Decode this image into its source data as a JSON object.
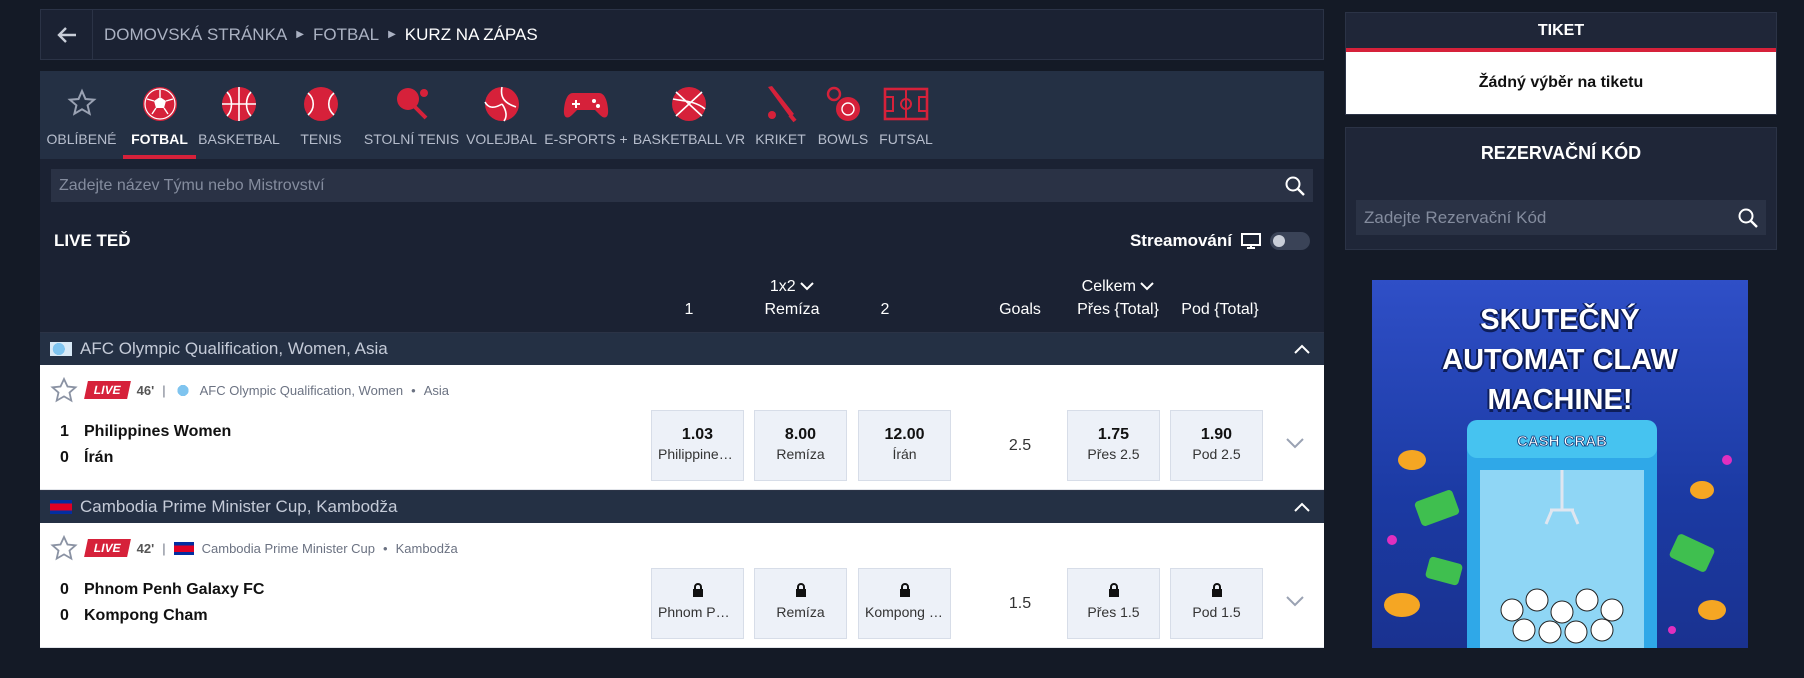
{
  "breadcrumb": {
    "items": [
      "DOMOVSKÁ STRÁNKA",
      "FOTBAL"
    ],
    "current": "KURZ NA ZÁPAS"
  },
  "sports": [
    {
      "label": "OBLÍBENÉ",
      "icon": "star-icon",
      "active": false
    },
    {
      "label": "FOTBAL",
      "icon": "football-icon",
      "active": true
    },
    {
      "label": "BASKETBAL",
      "icon": "basketball-icon",
      "active": false
    },
    {
      "label": "TENIS",
      "icon": "tennis-icon",
      "active": false
    },
    {
      "label": "STOLNÍ TENIS",
      "icon": "table-tennis-icon",
      "active": false
    },
    {
      "label": "VOLEJBAL",
      "icon": "volleyball-icon",
      "active": false
    },
    {
      "label": "E-SPORTS +",
      "icon": "gamepad-icon",
      "active": false
    },
    {
      "label": "BASKETBALL VR",
      "icon": "basketball-vr-icon",
      "active": false
    },
    {
      "label": "KRIKET",
      "icon": "cricket-icon",
      "active": false
    },
    {
      "label": "BOWLS",
      "icon": "bowls-icon",
      "active": false
    },
    {
      "label": "FUTSAL",
      "icon": "futsal-icon",
      "active": false
    }
  ],
  "search": {
    "placeholder": "Zadejte název Týmu nebo Mistrovství"
  },
  "live": {
    "title": "LIVE TEĎ",
    "stream_label": "Streamování"
  },
  "columns": {
    "market1": "1x2",
    "c1": "1",
    "draw": "Remíza",
    "c2": "2",
    "goals": "Goals",
    "market2": "Celkem",
    "over": "Přes {Total}",
    "under": "Pod {Total}"
  },
  "leagues": [
    {
      "name": "AFC Olympic Qualification, Women, Asia",
      "match": {
        "badge": "LIVE",
        "minute": "46'",
        "competition": "AFC Olympic Qualification, Women",
        "region": "Asia",
        "home": {
          "score": "1",
          "name": "Philippines Women"
        },
        "away": {
          "score": "0",
          "name": "Írán"
        },
        "odds": [
          {
            "value": "1.03",
            "label": "Philippines Women"
          },
          {
            "value": "8.00",
            "label": "Remíza"
          },
          {
            "value": "12.00",
            "label": "Írán"
          }
        ],
        "goals": "2.5",
        "over": {
          "value": "1.75",
          "label": "Přes 2.5"
        },
        "under": {
          "value": "1.90",
          "label": "Pod 2.5"
        }
      }
    },
    {
      "name": "Cambodia Prime Minister Cup, Kambodža",
      "match": {
        "badge": "LIVE",
        "minute": "42'",
        "competition": "Cambodia Prime Minister Cup",
        "region": "Kambodža",
        "home": {
          "score": "0",
          "name": "Phnom Penh Galaxy FC"
        },
        "away": {
          "score": "0",
          "name": "Kompong Cham"
        },
        "odds": [
          {
            "label": "Phnom Penh Galaxy FC"
          },
          {
            "label": "Remíza"
          },
          {
            "label": "Kompong Cham"
          }
        ],
        "goals": "1.5",
        "over": {
          "label": "Přes 1.5"
        },
        "under": {
          "label": "Pod 1.5"
        }
      }
    }
  ],
  "ticket": {
    "title": "TIKET",
    "empty": "Žádný výběr na tiketu"
  },
  "reservation": {
    "title": "REZERVAČNÍ KÓD",
    "placeholder": "Zadejte Rezervační Kód"
  },
  "ad": {
    "line1": "SKUTEČNÝ",
    "line2": "AUTOMAT CLAW",
    "line3": "MACHINE!",
    "logo": "CASH CRAB"
  },
  "colors": {
    "accent": "#d6213a",
    "background": "#141a26",
    "panel": "#1b2233"
  }
}
